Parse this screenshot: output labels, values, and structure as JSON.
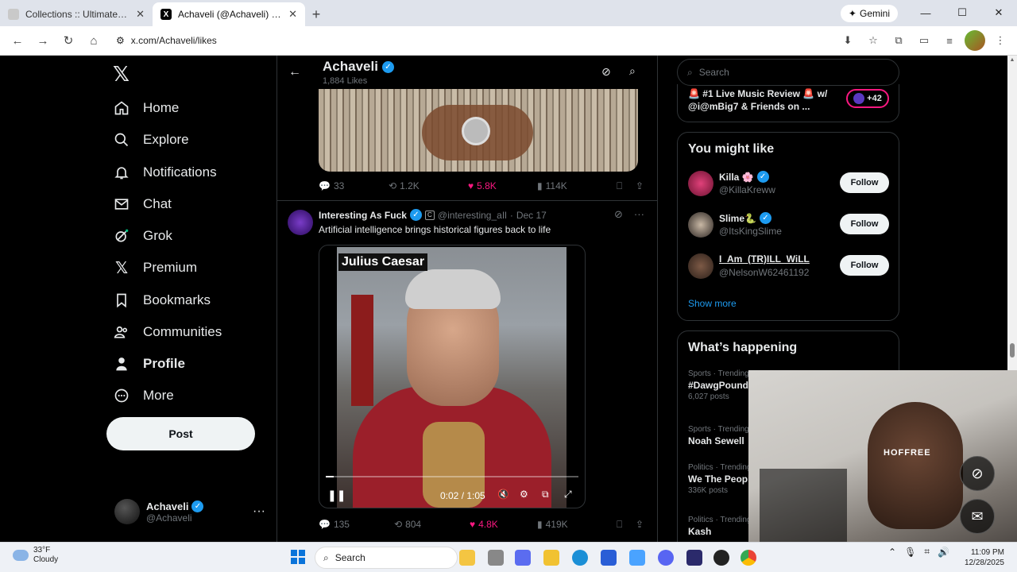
{
  "browser": {
    "tabs": [
      {
        "title": "Collections :: Ultimate Rap Leag",
        "active": false
      },
      {
        "title": "Achaveli (@Achaveli) / X",
        "active": true
      }
    ],
    "gemini_label": "Gemini",
    "url": "x.com/Achaveli/likes"
  },
  "nav": {
    "items": [
      {
        "label": "Home",
        "icon": "home-icon"
      },
      {
        "label": "Explore",
        "icon": "search-icon"
      },
      {
        "label": "Notifications",
        "icon": "bell-icon"
      },
      {
        "label": "Chat",
        "icon": "mail-icon"
      },
      {
        "label": "Grok",
        "icon": "grok-icon"
      },
      {
        "label": "Premium",
        "icon": "x-icon"
      },
      {
        "label": "Bookmarks",
        "icon": "bookmark-icon"
      },
      {
        "label": "Communities",
        "icon": "people-icon"
      },
      {
        "label": "Profile",
        "icon": "person-icon"
      },
      {
        "label": "More",
        "icon": "more-icon"
      }
    ],
    "post_label": "Post",
    "account": {
      "name": "Achaveli",
      "handle": "@Achaveli"
    }
  },
  "header": {
    "name": "Achaveli",
    "likes_count": "1,884 Likes"
  },
  "tweet1": {
    "replies": "33",
    "reposts": "1.2K",
    "likes": "5.8K",
    "views": "114K"
  },
  "tweet2": {
    "name": "Interesting As Fuck",
    "handle": "@interesting_aIl",
    "date": "Dec 17",
    "separator": "·",
    "text": "Artificial intelligence brings historical figures back to life",
    "video_caption": "Julius Caesar",
    "video_time": "0:02 / 1:05",
    "video_progress": 0.03,
    "replies": "135",
    "reposts": "804",
    "likes": "4.8K",
    "views": "419K"
  },
  "right": {
    "search_placeholder": "Search",
    "space_title": "🚨 #1 Live Music Review 🚨 w/ @i@mBig7 & Friends on ...",
    "space_count": "+42",
    "wtf_title": "You might like",
    "suggestions": [
      {
        "name": "Killa 🌸",
        "handle": "@KillaKreww",
        "follow": "Follow"
      },
      {
        "name": "Slime🐍",
        "handle": "@ItsKingSlime",
        "follow": "Follow"
      },
      {
        "name": "I_Am_(TR)ILL_WiLL",
        "handle": "@NelsonW62461192",
        "follow": "Follow"
      }
    ],
    "show_more": "Show more",
    "happening_title": "What’s happening",
    "trends": [
      {
        "category": "Sports · Trending",
        "title": "#DawgPound🐶",
        "posts": "6,027 posts"
      },
      {
        "category": "Sports · Trending",
        "title": "Noah Sewell",
        "posts": ""
      },
      {
        "category": "Politics · Trending",
        "title": "We The People",
        "posts": "336K posts"
      },
      {
        "category": "Politics · Trending",
        "title": "Kash",
        "posts": ""
      }
    ]
  },
  "webcam": {
    "shirt_text": "HOFFREE"
  },
  "taskbar": {
    "temp": "33°F",
    "weather": "Cloudy",
    "search_label": "Search",
    "time": "11:09 PM",
    "date": "12/28/2025"
  }
}
